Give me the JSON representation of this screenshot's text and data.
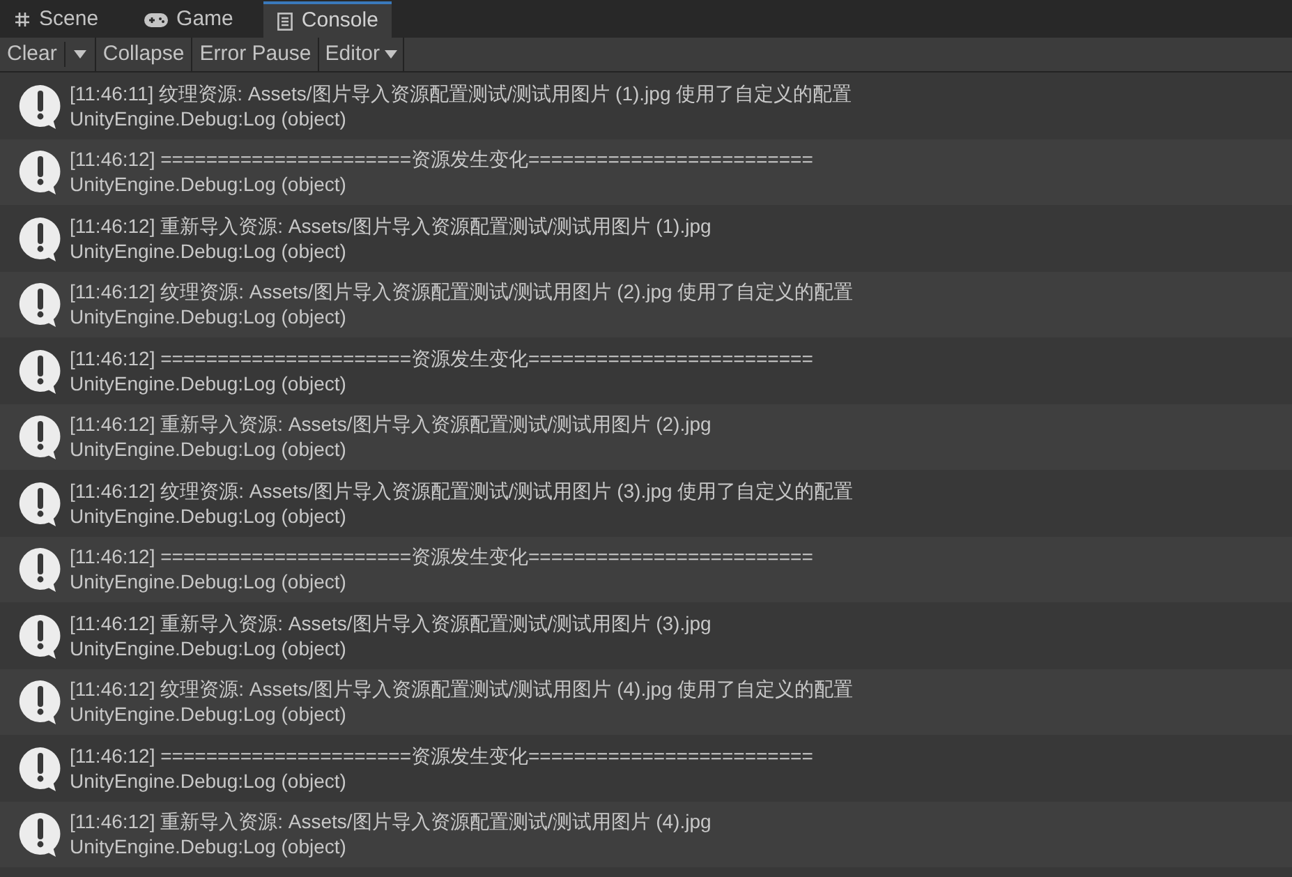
{
  "tabs": [
    {
      "label": "Scene",
      "kind": "scene",
      "selected": false
    },
    {
      "label": "Game",
      "kind": "game",
      "selected": false
    },
    {
      "label": "Console",
      "kind": "console",
      "selected": true
    }
  ],
  "toolbar": [
    {
      "label": "Clear",
      "kind": "split"
    },
    {
      "label": "Collapse",
      "kind": "toggle"
    },
    {
      "label": "Error Pause",
      "kind": "toggle"
    },
    {
      "label": "Editor",
      "kind": "dropdown"
    }
  ],
  "log_entries": [
    {
      "message": "[11:46:11] 纹理资源: Assets/图片导入资源配置测试/测试用图片 (1).jpg 使用了自定义的配置",
      "source": "UnityEngine.Debug:Log (object)"
    },
    {
      "message": "[11:46:12] ======================资源发生变化=========================",
      "source": "UnityEngine.Debug:Log (object)"
    },
    {
      "message": "[11:46:12] 重新导入资源: Assets/图片导入资源配置测试/测试用图片 (1).jpg",
      "source": "UnityEngine.Debug:Log (object)"
    },
    {
      "message": "[11:46:12] 纹理资源: Assets/图片导入资源配置测试/测试用图片 (2).jpg 使用了自定义的配置",
      "source": "UnityEngine.Debug:Log (object)"
    },
    {
      "message": "[11:46:12] ======================资源发生变化=========================",
      "source": "UnityEngine.Debug:Log (object)"
    },
    {
      "message": "[11:46:12] 重新导入资源: Assets/图片导入资源配置测试/测试用图片 (2).jpg",
      "source": "UnityEngine.Debug:Log (object)"
    },
    {
      "message": "[11:46:12] 纹理资源: Assets/图片导入资源配置测试/测试用图片 (3).jpg 使用了自定义的配置",
      "source": "UnityEngine.Debug:Log (object)"
    },
    {
      "message": "[11:46:12] ======================资源发生变化=========================",
      "source": "UnityEngine.Debug:Log (object)"
    },
    {
      "message": "[11:46:12] 重新导入资源: Assets/图片导入资源配置测试/测试用图片 (3).jpg",
      "source": "UnityEngine.Debug:Log (object)"
    },
    {
      "message": "[11:46:12] 纹理资源: Assets/图片导入资源配置测试/测试用图片 (4).jpg 使用了自定义的配置",
      "source": "UnityEngine.Debug:Log (object)"
    },
    {
      "message": "[11:46:12] ======================资源发生变化=========================",
      "source": "UnityEngine.Debug:Log (object)"
    },
    {
      "message": "[11:46:12] 重新导入资源: Assets/图片导入资源配置测试/测试用图片 (4).jpg",
      "source": "UnityEngine.Debug:Log (object)"
    }
  ]
}
